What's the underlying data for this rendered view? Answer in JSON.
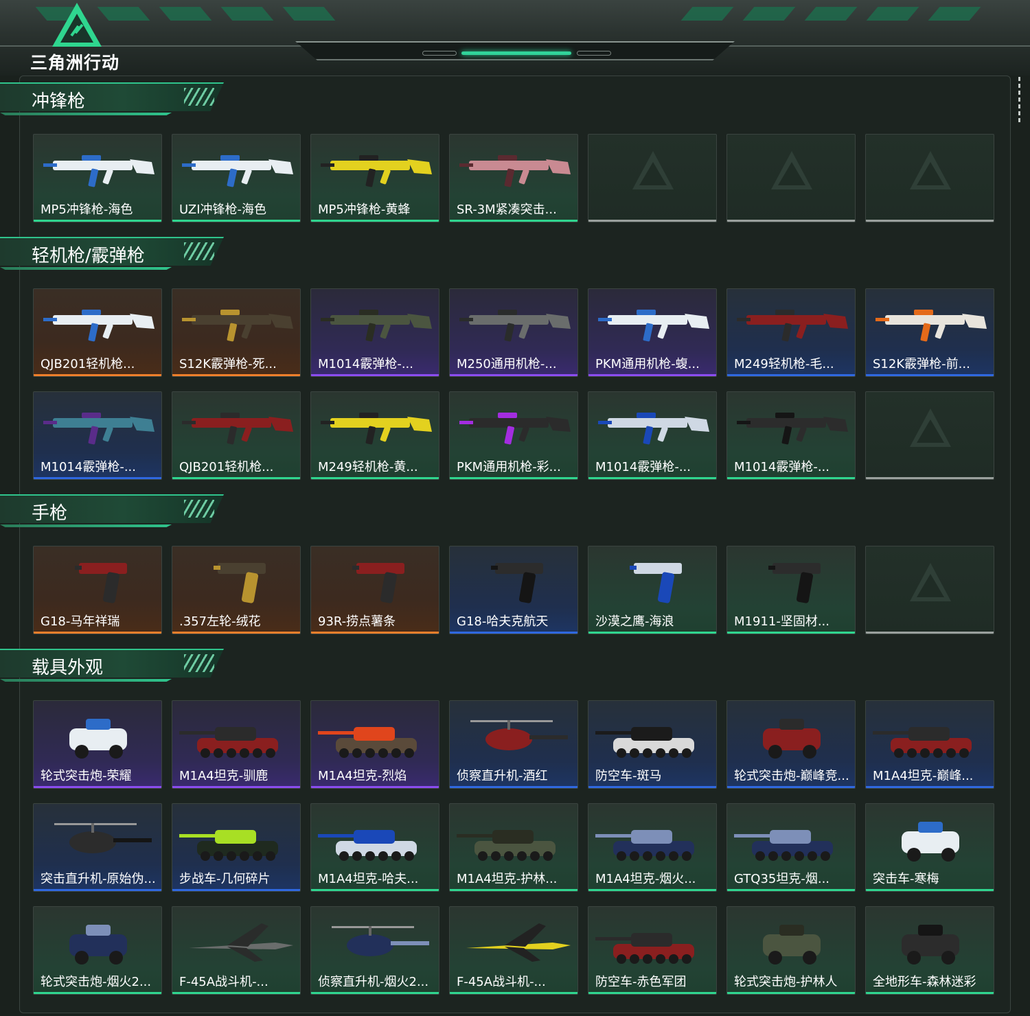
{
  "brand": {
    "name": "三角洲行动"
  },
  "colors": {
    "green": "#2fd68f",
    "orange": "#ef7f2b",
    "purple": "#8b4cf0",
    "blue": "#2f68e0",
    "empty": "#9aa09d"
  },
  "sections": [
    {
      "title": "冲锋枪",
      "rows": [
        [
          {
            "label": "MP5冲锋枪-海色",
            "rarity": "green",
            "thing": "smg-white"
          },
          {
            "label": "UZI冲锋枪-海色",
            "rarity": "green",
            "thing": "smg-white"
          },
          {
            "label": "MP5冲锋枪-黄蜂",
            "rarity": "green",
            "thing": "smg-yellow"
          },
          {
            "label": "SR-3M紧凑突击...",
            "rarity": "green",
            "thing": "smg-pink"
          },
          {
            "label": "",
            "rarity": "empty"
          },
          {
            "label": "",
            "rarity": "empty"
          },
          {
            "label": "",
            "rarity": "empty"
          }
        ]
      ]
    },
    {
      "title": "轻机枪/霰弹枪",
      "rows": [
        [
          {
            "label": "QJB201轻机枪...",
            "rarity": "orange",
            "thing": "lmg-white"
          },
          {
            "label": "S12K霰弹枪-死...",
            "rarity": "orange",
            "thing": "gun-gold"
          },
          {
            "label": "M1014霰弹枪-...",
            "rarity": "purple",
            "thing": "gun-camo"
          },
          {
            "label": "M250通用机枪-...",
            "rarity": "purple",
            "thing": "gun-gray"
          },
          {
            "label": "PKM通用机枪-蝮...",
            "rarity": "purple",
            "thing": "lmg-white"
          },
          {
            "label": "M249轻机枪-毛...",
            "rarity": "blue",
            "thing": "gun-red"
          },
          {
            "label": "S12K霰弹枪-前...",
            "rarity": "blue",
            "thing": "gun-orange"
          }
        ],
        [
          {
            "label": "M1014霰弹枪-...",
            "rarity": "blue",
            "thing": "gun-teal"
          },
          {
            "label": "QJB201轻机枪...",
            "rarity": "green",
            "thing": "gun-red"
          },
          {
            "label": "M249轻机枪-黄...",
            "rarity": "green",
            "thing": "smg-yellow"
          },
          {
            "label": "PKM通用机枪-彩...",
            "rarity": "green",
            "thing": "gun-purple"
          },
          {
            "label": "M1014霰弹枪-...",
            "rarity": "green",
            "thing": "gun-blue"
          },
          {
            "label": "M1014霰弹枪-...",
            "rarity": "green",
            "thing": "gun-black"
          },
          {
            "label": "",
            "rarity": "empty"
          }
        ]
      ]
    },
    {
      "title": "手枪",
      "rows": [
        [
          {
            "label": "G18-马年祥瑞",
            "rarity": "orange",
            "thing": "pistol-red"
          },
          {
            "label": ".357左轮-绒花",
            "rarity": "orange",
            "thing": "pistol-gold"
          },
          {
            "label": "93R-捞点薯条",
            "rarity": "orange",
            "thing": "pistol-red"
          },
          {
            "label": "G18-哈夫克航天",
            "rarity": "blue",
            "thing": "pistol-black"
          },
          {
            "label": "沙漠之鹰-海浪",
            "rarity": "green",
            "thing": "pistol-blue"
          },
          {
            "label": "M1911-坚固材...",
            "rarity": "green",
            "thing": "pistol-black"
          },
          {
            "label": "",
            "rarity": "empty"
          }
        ]
      ]
    },
    {
      "title": "载具外观",
      "rows": [
        [
          {
            "label": "轮式突击炮-荣耀",
            "rarity": "purple",
            "thing": "car-white"
          },
          {
            "label": "M1A4坦克-驯鹿",
            "rarity": "purple",
            "thing": "tank-red"
          },
          {
            "label": "M1A4坦克-烈焰",
            "rarity": "purple",
            "thing": "tank-fire"
          },
          {
            "label": "侦察直升机-酒红",
            "rarity": "blue",
            "thing": "heli-red"
          },
          {
            "label": "防空车-斑马",
            "rarity": "blue",
            "thing": "apc-zebra"
          },
          {
            "label": "轮式突击炮-巅峰竞...",
            "rarity": "blue",
            "thing": "car-red"
          },
          {
            "label": "M1A4坦克-巅峰...",
            "rarity": "blue",
            "thing": "tank-red"
          }
        ],
        [
          {
            "label": "突击直升机-原始伪...",
            "rarity": "blue",
            "thing": "heli-black"
          },
          {
            "label": "步战车-几何碎片",
            "rarity": "blue",
            "thing": "apc-green"
          },
          {
            "label": "M1A4坦克-哈夫...",
            "rarity": "green",
            "thing": "tank-blue"
          },
          {
            "label": "M1A4坦克-护林...",
            "rarity": "green",
            "thing": "tank-camo"
          },
          {
            "label": "M1A4坦克-烟火...",
            "rarity": "green",
            "thing": "tank-navy"
          },
          {
            "label": "GTQ35坦克-烟...",
            "rarity": "green",
            "thing": "tank-navy"
          },
          {
            "label": "突击车-寒梅",
            "rarity": "green",
            "thing": "car-white"
          }
        ],
        [
          {
            "label": "轮式突击炮-烟火2...",
            "rarity": "green",
            "thing": "car-navy"
          },
          {
            "label": "F-45A战斗机-...",
            "rarity": "green",
            "thing": "jet-gray"
          },
          {
            "label": "侦察直升机-烟火2...",
            "rarity": "green",
            "thing": "heli-navy"
          },
          {
            "label": "F-45A战斗机-...",
            "rarity": "green",
            "thing": "jet-yellow"
          },
          {
            "label": "防空车-赤色军团",
            "rarity": "green",
            "thing": "apc-red"
          },
          {
            "label": "轮式突击炮-护林人",
            "rarity": "green",
            "thing": "car-camo"
          },
          {
            "label": "全地形车-森林迷彩",
            "rarity": "green",
            "thing": "atv-black"
          }
        ]
      ]
    }
  ]
}
